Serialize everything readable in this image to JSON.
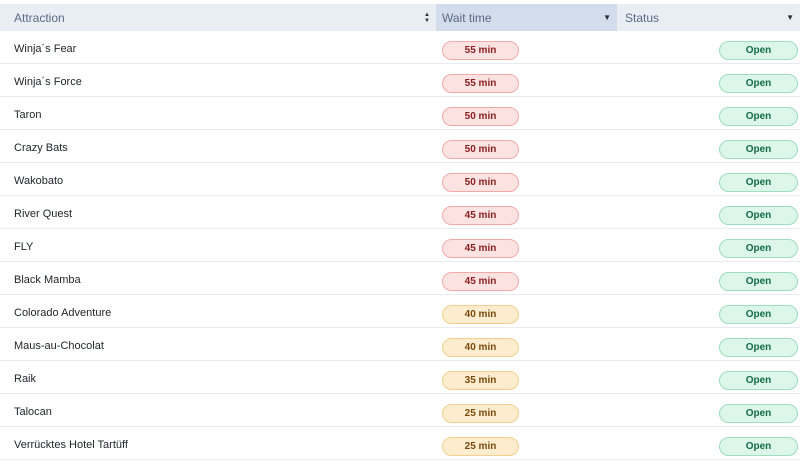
{
  "columns": {
    "attraction": "Attraction",
    "wait": "Wait time",
    "status": "Status"
  },
  "icons": {
    "attraction_sort": "sort-both-icon",
    "wait_sort": "sort-desc-icon",
    "status_sort": "sort-desc-icon"
  },
  "colors": {
    "red_pill": "#fde2e2",
    "orange_pill": "#fdeccd",
    "green_pill": "#dcf6ea"
  },
  "rows": [
    {
      "name": "Winja´s Fear",
      "wait": "55 min",
      "level": "red",
      "status": "Open"
    },
    {
      "name": "Winja´s Force",
      "wait": "55 min",
      "level": "red",
      "status": "Open"
    },
    {
      "name": "Taron",
      "wait": "50 min",
      "level": "red",
      "status": "Open"
    },
    {
      "name": "Crazy Bats",
      "wait": "50 min",
      "level": "red",
      "status": "Open"
    },
    {
      "name": "Wakobato",
      "wait": "50 min",
      "level": "red",
      "status": "Open"
    },
    {
      "name": "River Quest",
      "wait": "45 min",
      "level": "red",
      "status": "Open"
    },
    {
      "name": "FLY",
      "wait": "45 min",
      "level": "red",
      "status": "Open"
    },
    {
      "name": "Black Mamba",
      "wait": "45 min",
      "level": "red",
      "status": "Open"
    },
    {
      "name": "Colorado Adventure",
      "wait": "40 min",
      "level": "orange",
      "status": "Open"
    },
    {
      "name": "Maus-au-Chocolat",
      "wait": "40 min",
      "level": "orange",
      "status": "Open"
    },
    {
      "name": "Raik",
      "wait": "35 min",
      "level": "orange",
      "status": "Open"
    },
    {
      "name": "Talocan",
      "wait": "25 min",
      "level": "orange",
      "status": "Open"
    },
    {
      "name": "Verrücktes Hotel Tartüff",
      "wait": "25 min",
      "level": "orange",
      "status": "Open"
    }
  ]
}
